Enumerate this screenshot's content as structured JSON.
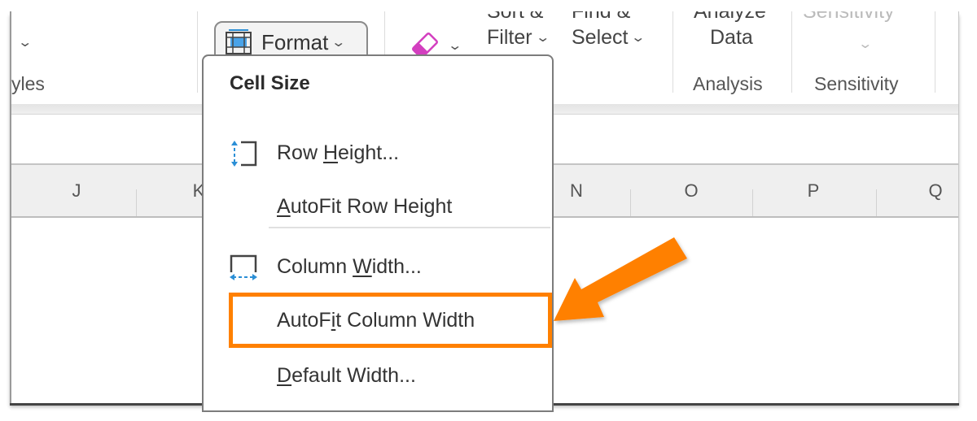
{
  "ribbon": {
    "styles_group_label_partial": "yles",
    "format_button_label": "Format",
    "sort_filter": {
      "top_partial": "Sort &",
      "label": "Filter"
    },
    "find_select": {
      "top_partial": "Find &",
      "label": "Select"
    },
    "analyze_data": {
      "top_partial": "Analyze",
      "label": "Data",
      "group_label": "Analysis"
    },
    "sensitivity": {
      "top_partial": "Sensitivity",
      "group_label": "Sensitivity"
    }
  },
  "columns": [
    "J",
    "K",
    "N",
    "O",
    "P",
    "Q"
  ],
  "format_menu": {
    "section_heading": "Cell Size",
    "items": [
      {
        "label_pre": "Row ",
        "label_u": "H",
        "label_post": "eight...",
        "icon": "row-height-icon"
      },
      {
        "label_pre": "",
        "label_u": "A",
        "label_post": "utoFit Row Height",
        "icon": ""
      },
      {
        "label_pre": "Column ",
        "label_u": "W",
        "label_post": "idth...",
        "icon": "column-width-icon"
      },
      {
        "label_pre": "AutoF",
        "label_u": "i",
        "label_post": "t Column Width",
        "icon": "",
        "highlighted": true
      },
      {
        "label_pre": "",
        "label_u": "D",
        "label_post": "efault Width...",
        "icon": ""
      }
    ]
  },
  "annotation": {
    "highlight_color": "#ff8000",
    "arrow_color": "#ff8000"
  },
  "colors": {
    "accent_blue": "#2b8fd6",
    "eraser_pink": "#d33fbf"
  }
}
